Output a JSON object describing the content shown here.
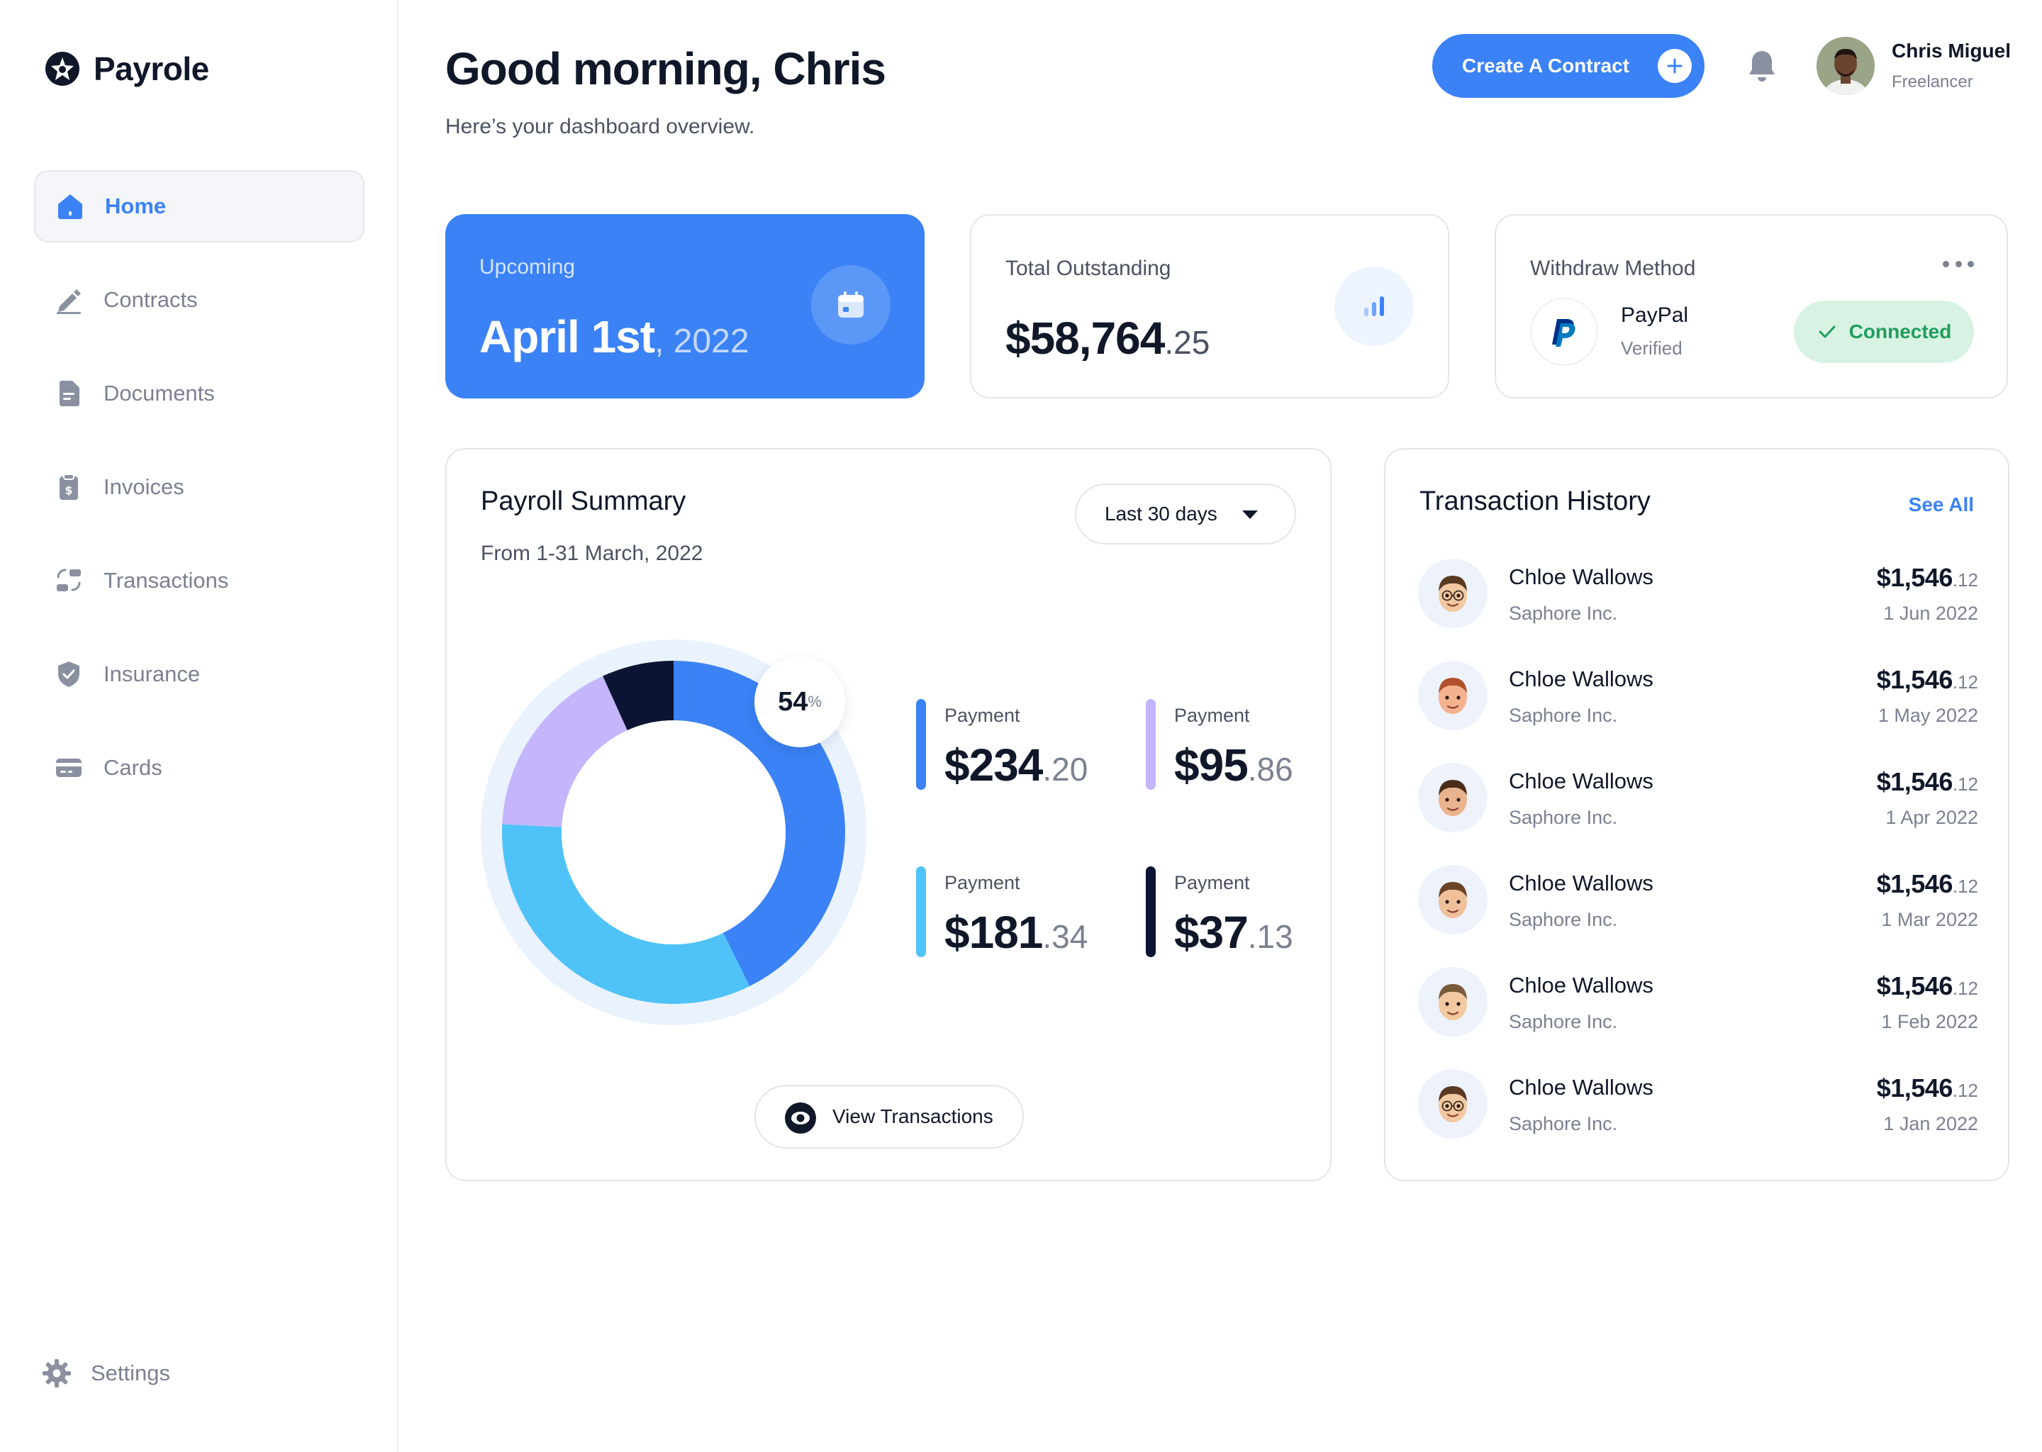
{
  "brand": {
    "name": "Payrole"
  },
  "sidebar": {
    "items": [
      {
        "label": "Home",
        "icon": "home-icon",
        "active": true
      },
      {
        "label": "Contracts",
        "icon": "pen-icon",
        "active": false
      },
      {
        "label": "Documents",
        "icon": "document-icon",
        "active": false
      },
      {
        "label": "Invoices",
        "icon": "invoice-icon",
        "active": false
      },
      {
        "label": "Transactions",
        "icon": "transactions-icon",
        "active": false
      },
      {
        "label": "Insurance",
        "icon": "shield-icon",
        "active": false
      },
      {
        "label": "Cards",
        "icon": "card-icon",
        "active": false
      }
    ],
    "settings_label": "Settings"
  },
  "header": {
    "greeting": "Good morning, Chris",
    "subtitle": "Here’s your dashboard overview.",
    "create_button": "Create A Contract",
    "user": {
      "name": "Chris Miguel",
      "role": "Freelancer"
    }
  },
  "stats": {
    "upcoming": {
      "label": "Upcoming",
      "date": "April 1st",
      "year": ", 2022"
    },
    "outstanding": {
      "label": "Total Outstanding",
      "amount": "$58,764",
      "cents": ".25"
    },
    "withdraw": {
      "label": "Withdraw Method",
      "provider": "PayPal",
      "status": "Verified",
      "connection": "Connected"
    }
  },
  "payroll": {
    "title": "Payroll Summary",
    "period": "From 1-31 March, 2022",
    "range": "Last 30 days",
    "percent": "54",
    "percent_sign": "%",
    "view_button": "View Transactions",
    "payments": [
      {
        "label": "Payment",
        "amount": "$234",
        "cents": ".20",
        "color": "#3b82f6"
      },
      {
        "label": "Payment",
        "amount": "$95",
        "cents": ".86",
        "color": "#c4b5fd"
      },
      {
        "label": "Payment",
        "amount": "$181",
        "cents": ".34",
        "color": "#4fc3f7"
      },
      {
        "label": "Payment",
        "amount": "$37",
        "cents": ".13",
        "color": "#0b1433"
      }
    ]
  },
  "chart_data": {
    "type": "pie",
    "categories": [
      "Payment 1",
      "Payment 2",
      "Payment 3",
      "Payment 4"
    ],
    "values": [
      234.2,
      95.86,
      181.34,
      37.13
    ],
    "colors": [
      "#3b82f6",
      "#c4b5fd",
      "#4fc3f7",
      "#0b1433"
    ],
    "donut": true,
    "highlight_label": "54%",
    "legend": "right"
  },
  "transactions": {
    "title": "Transaction History",
    "see_all": "See All",
    "rows": [
      {
        "name": "Chloe Wallows",
        "company": "Saphore Inc.",
        "amount": "$1,546",
        "cents": ".12",
        "date": "1 Jun 2022",
        "avatar_skin": "#f2c9a0",
        "avatar_hair": "#5a3a22",
        "glasses": true
      },
      {
        "name": "Chloe Wallows",
        "company": "Saphore Inc.",
        "amount": "$1,546",
        "cents": ".12",
        "date": "1 May 2022",
        "avatar_skin": "#f4b38e",
        "avatar_hair": "#b0502a",
        "glasses": false
      },
      {
        "name": "Chloe Wallows",
        "company": "Saphore Inc.",
        "amount": "$1,546",
        "cents": ".12",
        "date": "1 Apr 2022",
        "avatar_skin": "#e9b48d",
        "avatar_hair": "#4a2c1a",
        "glasses": false
      },
      {
        "name": "Chloe Wallows",
        "company": "Saphore Inc.",
        "amount": "$1,546",
        "cents": ".12",
        "date": "1 Mar 2022",
        "avatar_skin": "#f0c09a",
        "avatar_hair": "#6b4428",
        "glasses": false
      },
      {
        "name": "Chloe Wallows",
        "company": "Saphore Inc.",
        "amount": "$1,546",
        "cents": ".12",
        "date": "1 Feb 2022",
        "avatar_skin": "#f2c9a0",
        "avatar_hair": "#7a5a3a",
        "glasses": false
      },
      {
        "name": "Chloe Wallows",
        "company": "Saphore Inc.",
        "amount": "$1,546",
        "cents": ".12",
        "date": "1 Jan 2022",
        "avatar_skin": "#f2c9a0",
        "avatar_hair": "#5a3a22",
        "glasses": true
      }
    ]
  },
  "colors": {
    "accent": "#3b82f6",
    "success": "#1e9e5b",
    "text_primary": "#0f1729",
    "text_muted": "#7b8191"
  }
}
